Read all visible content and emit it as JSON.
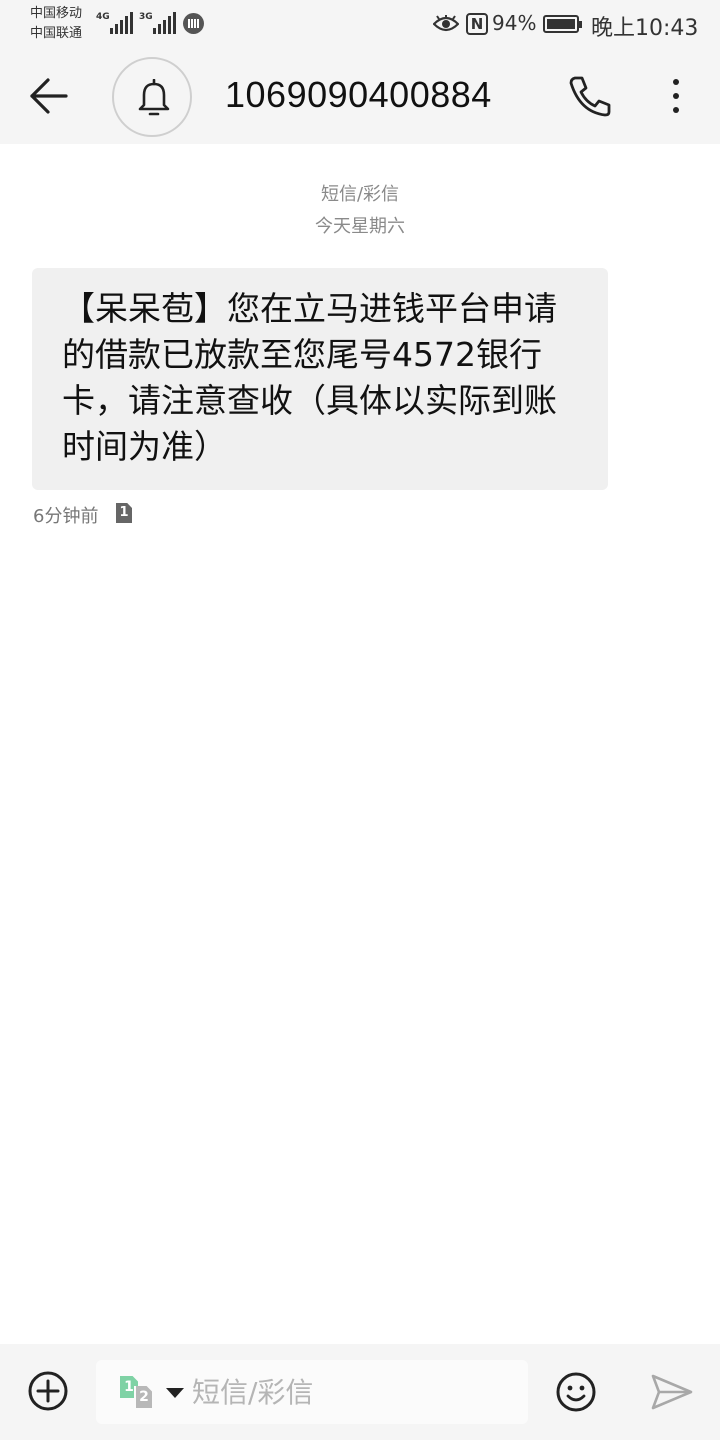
{
  "status_bar": {
    "carrier_1": "中国移动",
    "carrier_2": "中国联通",
    "sim1_network": "4G",
    "sim2_network": "3G",
    "battery": "94%",
    "time": "晚上10:43"
  },
  "header": {
    "contact": "1069090400884"
  },
  "conversation": {
    "channel_label": "短信/彩信",
    "date_label": "今天星期六",
    "messages": [
      {
        "text": "【呆呆苞】您在立马进钱平台申请的借款已放款至您尾号4572银行卡，请注意查收（具体以实际到账时间为准）",
        "time_ago": "6分钟前",
        "sim": "1"
      }
    ]
  },
  "composer": {
    "sim_primary": "1",
    "sim_secondary": "2",
    "placeholder": "短信/彩信"
  },
  "colors": {
    "bar_background": "#f5f5f5",
    "bubble_background": "#f0f0f0",
    "sim1_green": "#7fd2a5"
  },
  "icons": [
    "back-arrow-icon",
    "bell-icon",
    "phone-icon",
    "more-icon",
    "add-icon",
    "emoji-icon",
    "send-icon",
    "eye-icon",
    "nfc-icon",
    "battery-icon"
  ]
}
